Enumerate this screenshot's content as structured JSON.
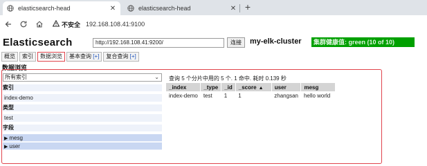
{
  "browser": {
    "tabs": [
      {
        "title": "elasticsearch-head",
        "active": true
      },
      {
        "title": "elasticsearch-head",
        "active": false
      }
    ],
    "insecure_label": "不安全",
    "url": "192.168.108.41:9100"
  },
  "header": {
    "app_title": "Elasticsearch",
    "connect_url": "http://192.168.108.41:9200/",
    "connect_label": "连接",
    "cluster_name": "my-elk-cluster",
    "health_text": "集群健康值: green (10 of 10)",
    "health_color": "#00a000"
  },
  "main_tabs": [
    {
      "label": "概览",
      "plus": ""
    },
    {
      "label": "索引",
      "plus": ""
    },
    {
      "label": "数据浏览",
      "plus": "",
      "active": true
    },
    {
      "label": "基本查询 ",
      "plus": "[+]"
    },
    {
      "label": "复合查询 ",
      "plus": "[+]"
    }
  ],
  "browser_view": {
    "section_title": "数据浏览",
    "index_select": "所有索引",
    "groups": {
      "index_label": "索引",
      "index_value": "index-demo",
      "type_label": "类型",
      "type_value": "test",
      "field_label": "字段",
      "fields": [
        "mesg",
        "user"
      ]
    },
    "summary": "查询 5 个分片中用的 5 个. 1 命中. 耗时 0.139 秒",
    "columns": [
      "_index",
      "_type",
      "_id",
      "_score",
      "user",
      "mesg"
    ],
    "rows": [
      [
        "index-demo",
        "test",
        "1",
        "1",
        "zhangsan",
        "hello world"
      ]
    ]
  },
  "colors": {
    "accent_red": "#e0434b",
    "field_bg": "#c9d7f2",
    "header_gray": "#d4d4d4"
  }
}
